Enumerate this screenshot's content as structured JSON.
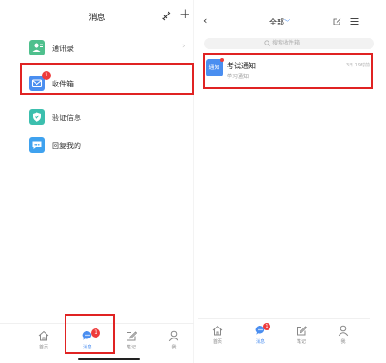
{
  "left": {
    "title": "消息",
    "items": [
      {
        "label": "通讯录",
        "icon": "contacts-icon",
        "chevron": "›"
      },
      {
        "label": "收件箱",
        "icon": "inbox-icon",
        "badge": "1"
      },
      {
        "label": "验证信息",
        "icon": "shield-check-icon"
      },
      {
        "label": "回复我的",
        "icon": "chat-reply-icon"
      }
    ],
    "plus": "+"
  },
  "right": {
    "back": "‹",
    "title": "全部",
    "title_arrow": "﹀",
    "search_placeholder": "搜索收件箱",
    "message": {
      "avatar_text": "通知",
      "title": "考试通知",
      "subtitle": "学习通知",
      "time": "3日 19时前"
    }
  },
  "tabbar": {
    "tabs": [
      {
        "label": "首页",
        "icon": "home-icon"
      },
      {
        "label": "消息",
        "icon": "message-icon",
        "badge": "1",
        "active": true
      },
      {
        "label": "笔记",
        "icon": "note-icon"
      },
      {
        "label": "我",
        "icon": "profile-icon"
      }
    ]
  },
  "colors": {
    "accent": "#4a8ef0",
    "highlight": "#e02323",
    "badge": "#ee3b3b"
  }
}
